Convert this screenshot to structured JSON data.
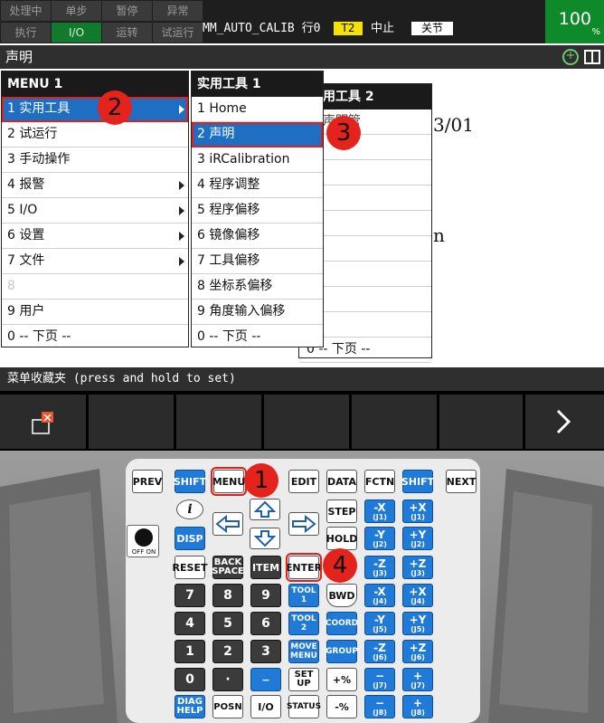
{
  "status": {
    "row1": [
      "处理中",
      "单步",
      "暂停",
      "异常"
    ],
    "row2": [
      "执行",
      "I/O",
      "运转",
      "试运行"
    ],
    "program": "MM_AUTO_CALIB 行0",
    "mode": "T2",
    "state": "中止",
    "coord": "关节",
    "override": "100",
    "override_unit": "%"
  },
  "screen_title": "声明",
  "background_text": {
    "date": "3/01",
    "letter": "n"
  },
  "menu": {
    "header": "MENU   1",
    "items": [
      "1 实用工具",
      "2 试运行",
      "3 手动操作",
      "4 报警",
      "5 I/O",
      "6 设置",
      "7 文件",
      "8",
      "9 用户",
      "0 -- 下页 --"
    ]
  },
  "submenu": {
    "header": "实用工具   1",
    "items": [
      "1 Home",
      "2 声明",
      "3 iRCalibration",
      "4 程序调整",
      "5 程序偏移",
      "6 镜像偏移",
      "7 工具偏移",
      "8 坐标系偏移",
      "9 角度输入偏移",
      "0 -- 下页 --"
    ]
  },
  "menu_bg": {
    "header": "用工具   2",
    "partial": "声明管",
    "last": "0 -- 下页 --"
  },
  "favorites_bar": "菜单收藏夹 (press and hold to set)",
  "keys": {
    "prev": "PREV",
    "shift": "SHIFT",
    "menu": "MENU",
    "edit": "EDIT",
    "data": "DATA",
    "fctn": "FCTN",
    "next": "NEXT",
    "info": "i",
    "disp": "DISP",
    "step": "STEP",
    "hold": "HOLD",
    "reset": "RESET",
    "backspace_1": "BACK",
    "backspace_2": "SPACE",
    "item": "ITEM",
    "enter": "ENTER",
    "tool1_a": "TOOL",
    "tool1_b": "1",
    "tool2_a": "TOOL",
    "tool2_b": "2",
    "bwd": "BWD",
    "coord": "COORD",
    "group": "GROUP",
    "move_a": "MOVE",
    "move_b": "MENU",
    "setup_a": "SET",
    "setup_b": "UP",
    "status": "STATUS",
    "diag_a": "DIAG",
    "diag_b": "HELP",
    "posn": "POSN",
    "io": "I/O",
    "plus_pct": "+%",
    "minus_pct": "-%",
    "num7": "7",
    "num8": "8",
    "num9": "9",
    "num4": "4",
    "num5": "5",
    "num6": "6",
    "num1": "1",
    "num2": "2",
    "num3": "3",
    "num0": "0",
    "dot": "·",
    "minus": "−",
    "off_on": "OFF  ON"
  },
  "jog": [
    [
      "-X",
      "(J1)",
      "+X",
      "(J1)"
    ],
    [
      "-Y",
      "(J2)",
      "+Y",
      "(J2)"
    ],
    [
      "-Z",
      "(J3)",
      "+Z",
      "(J3)"
    ],
    [
      "-X",
      "(J4)",
      "+X",
      "(J4)"
    ],
    [
      "-Y",
      "(J5)",
      "+Y",
      "(J5)"
    ],
    [
      "-Z",
      "(J6)",
      "+Z",
      "(J6)"
    ],
    [
      "−",
      "(J7)",
      "+",
      "(J7)"
    ],
    [
      "−",
      "(J8)",
      "+",
      "(J8)"
    ]
  ],
  "annotations": [
    "1",
    "2",
    "3",
    "4"
  ],
  "colors": {
    "highlight": "#1e6fc4",
    "annotation": "#e3231c",
    "key_blue": "#1f7ad8",
    "status_green": "#0e8a2a"
  }
}
